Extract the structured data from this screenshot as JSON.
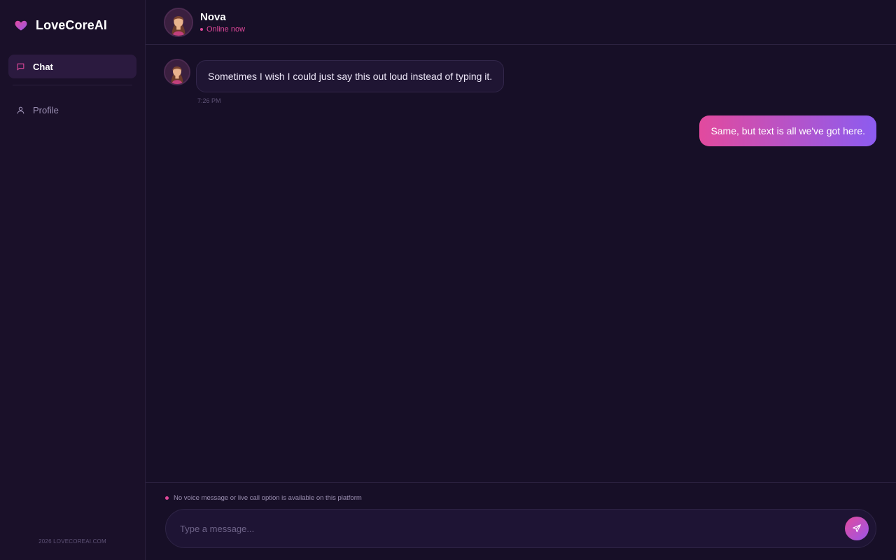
{
  "app": {
    "name": "LoveCoreAI",
    "copyright": "2026 LOVECOREAI.COM"
  },
  "sidebar": {
    "items": [
      {
        "label": "Chat",
        "icon": "chat-bubble-icon",
        "active": true
      },
      {
        "label": "Profile",
        "icon": "user-icon",
        "active": false
      }
    ]
  },
  "chat": {
    "contact_name": "Nova",
    "status": "Online now",
    "messages": [
      {
        "from": "Nova",
        "text": "Sometimes I wish I could just say this out loud instead of typing it.",
        "time": "7:26 PM"
      },
      {
        "from": "me",
        "text": "Same, but text is all we've got here."
      }
    ]
  },
  "composer": {
    "notice": "No voice message or live call option is available on this platform",
    "placeholder": "Type a message...",
    "send_icon": "send-icon"
  },
  "colors": {
    "background": "#170f27",
    "sidebar": "#1a1029",
    "accent_pink": "#e24a9e",
    "accent_purple": "#8c5cf0",
    "status": "#e0489a"
  }
}
